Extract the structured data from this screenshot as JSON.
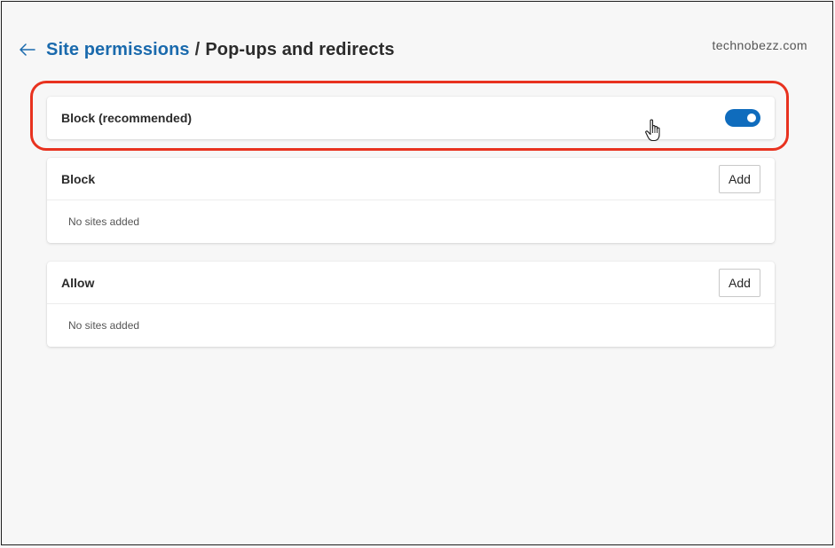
{
  "header": {
    "back_icon": "arrow-left-icon",
    "breadcrumb_parent": "Site permissions",
    "separator": "/",
    "breadcrumb_current": "Pop-ups and redirects"
  },
  "watermark": "technobezz.com",
  "block_recommended": {
    "label": "Block (recommended)",
    "toggle_on": true,
    "toggle_color": "#0f6cbd"
  },
  "block_list": {
    "title": "Block",
    "add_label": "Add",
    "empty_text": "No sites added"
  },
  "allow_list": {
    "title": "Allow",
    "add_label": "Add",
    "empty_text": "No sites added"
  },
  "colors": {
    "link": "#1a6aad",
    "highlight": "#e8321f"
  }
}
